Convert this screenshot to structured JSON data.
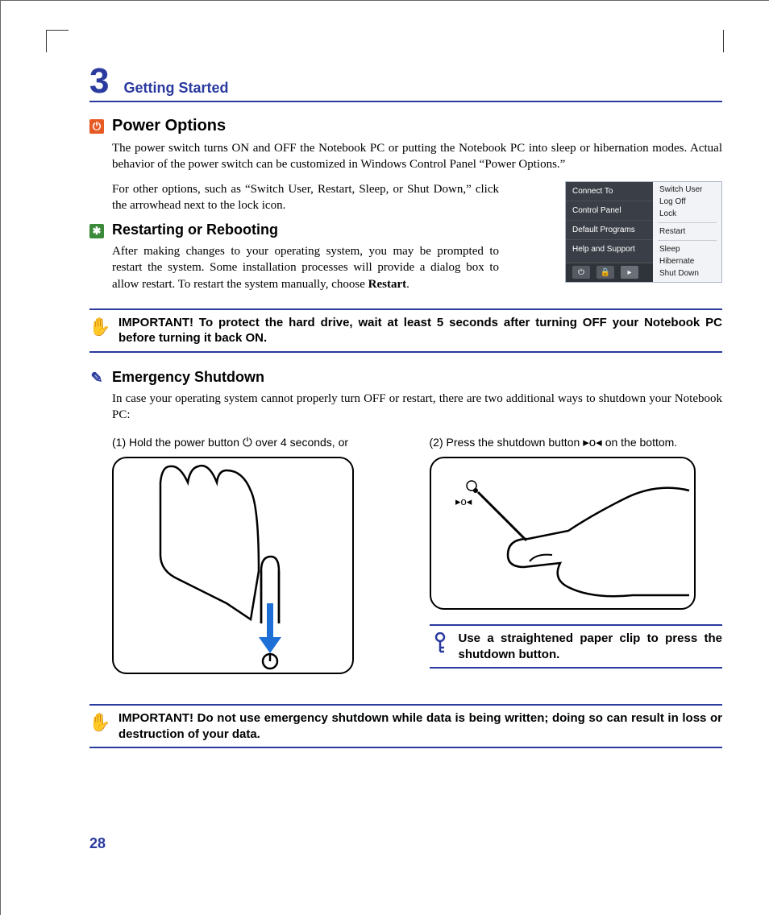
{
  "chapter": {
    "num": "3",
    "title": "Getting Started"
  },
  "power": {
    "heading": "Power Options",
    "p1": "The power switch turns ON and OFF the Notebook PC or putting the Notebook PC into sleep or hibernation modes. Actual behavior of the power switch can be customized in Windows Control Panel “Power Options.”",
    "p2": "For other options, such as “Switch User, Restart, Sleep, or Shut Down,” click the arrowhead next to the lock icon."
  },
  "restart": {
    "heading": "Restarting or Rebooting",
    "p1_a": "After making changes to your operating system, you may be prompted to restart the system. Some installation processes will provide a dialog box to allow restart. To restart the system manually, choose ",
    "p1_b": "Restart",
    "p1_c": "."
  },
  "note1": "IMPORTANT!  To protect the hard drive, wait at least 5 seconds after turning OFF your Notebook PC before turning it back ON.",
  "emergency": {
    "heading": "Emergency Shutdown",
    "p1": "In case your operating system cannot properly turn OFF or restart, there are two additional ways to shutdown your Notebook PC:",
    "opt1_a": "(1) Hold the power button",
    "opt1_b": "over 4 seconds, or",
    "opt2_a": "(2) Press the shutdown button",
    "opt2_b": "on the bottom."
  },
  "tip": "Use a straightened paper clip to press the shutdown button.",
  "note2": "IMPORTANT!  Do not use emergency shutdown while data is being written; doing so can result in loss or destruction of your data.",
  "winmenu": {
    "left": [
      "Connect To",
      "Control Panel",
      "Default Programs",
      "Help and Support"
    ],
    "right": [
      "Switch User",
      "Log Off",
      "Lock",
      "Restart",
      "Sleep",
      "Hibernate",
      "Shut Down"
    ]
  },
  "page_number": "28"
}
